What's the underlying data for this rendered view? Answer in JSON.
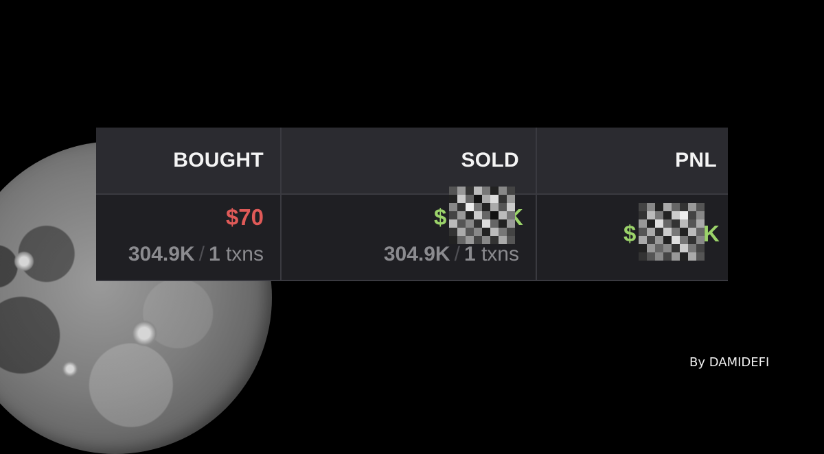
{
  "columns": {
    "bought": {
      "header": "BOUGHT",
      "value": "$70",
      "value_color": "#e05a58",
      "amount": "304.9K",
      "separator": "/",
      "txns_count": "1",
      "txns_label": "txns"
    },
    "sold": {
      "header": "SOLD",
      "value_visible_prefix": "$",
      "value_visible_suffix": "K",
      "value_color": "#9bd36a",
      "amount": "304.9K",
      "separator": "/",
      "txns_count": "1",
      "txns_label": "txns"
    },
    "pnl": {
      "header": "PNL",
      "value_visible_prefix": "$",
      "value_visible_suffix": "K",
      "value_color": "#9bd36a"
    }
  },
  "redaction": "pixelated",
  "credit": "By DAMIDEFI",
  "background": {
    "image": "moon",
    "color": "#000000"
  }
}
